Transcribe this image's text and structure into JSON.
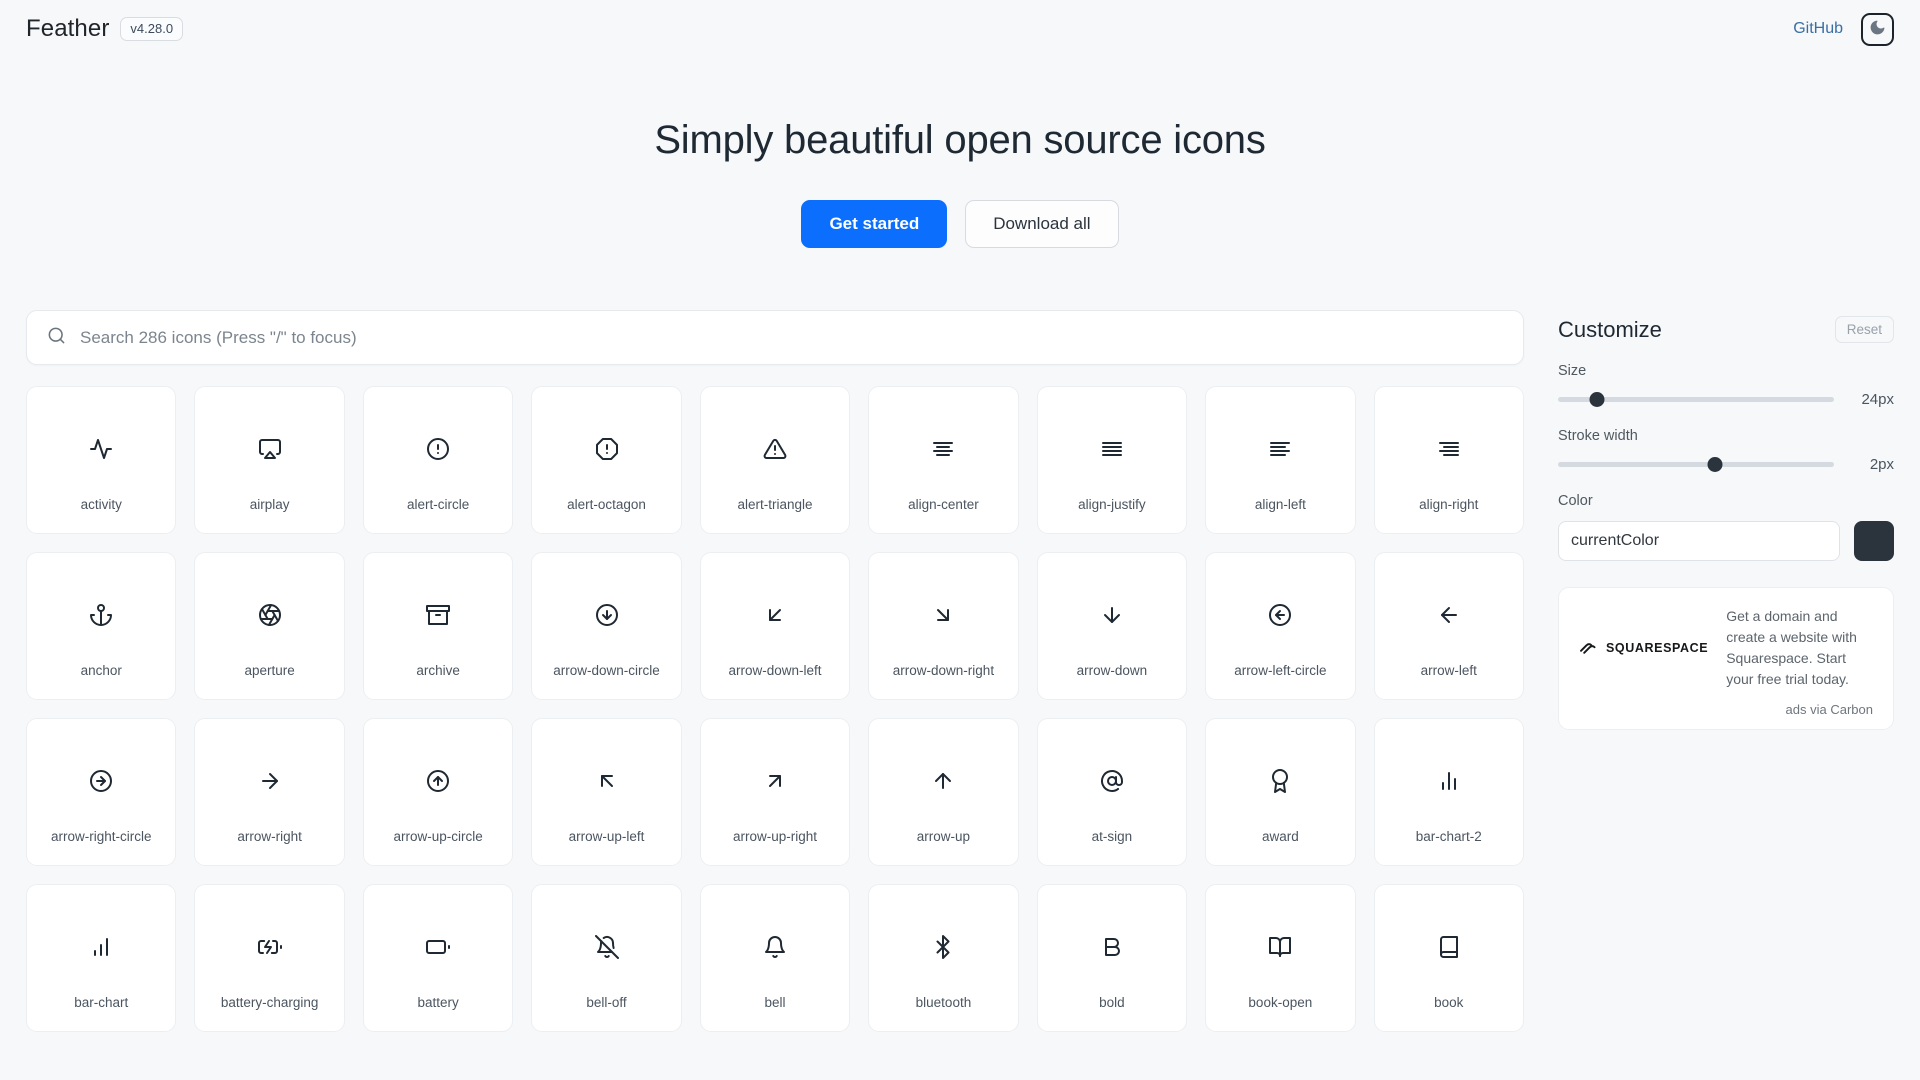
{
  "header": {
    "brand": "Feather",
    "version": "v4.28.0",
    "github_label": "GitHub",
    "theme_toggle_icon": "moon-icon"
  },
  "hero": {
    "title": "Simply beautiful open source icons",
    "primary_button": "Get started",
    "secondary_button": "Download all"
  },
  "search": {
    "icon": "search-icon",
    "placeholder": "Search 286 icons (Press \"/\" to focus)",
    "value": "",
    "icon_count": 286
  },
  "customize": {
    "title": "Customize",
    "reset_label": "Reset",
    "size": {
      "label": "Size",
      "value": "24px",
      "percent": 14
    },
    "stroke": {
      "label": "Stroke width",
      "value": "2px",
      "percent": 57
    },
    "color": {
      "label": "Color",
      "value": "currentColor",
      "swatch": "#2b333c"
    }
  },
  "ad": {
    "logo_name": "squarespace-logo",
    "logo_text": "SQUARESPACE",
    "text": "Get a domain and create a website with Squarespace. Start your free trial today.",
    "footer": "ads via Carbon"
  },
  "icons": [
    {
      "name": "activity"
    },
    {
      "name": "airplay"
    },
    {
      "name": "alert-circle"
    },
    {
      "name": "alert-octagon"
    },
    {
      "name": "alert-triangle"
    },
    {
      "name": "align-center"
    },
    {
      "name": "align-justify"
    },
    {
      "name": "align-left"
    },
    {
      "name": "align-right"
    },
    {
      "name": "anchor"
    },
    {
      "name": "aperture"
    },
    {
      "name": "archive"
    },
    {
      "name": "arrow-down-circle"
    },
    {
      "name": "arrow-down-left"
    },
    {
      "name": "arrow-down-right"
    },
    {
      "name": "arrow-down"
    },
    {
      "name": "arrow-left-circle"
    },
    {
      "name": "arrow-left"
    },
    {
      "name": "arrow-right-circle"
    },
    {
      "name": "arrow-right"
    },
    {
      "name": "arrow-up-circle"
    },
    {
      "name": "arrow-up-left"
    },
    {
      "name": "arrow-up-right"
    },
    {
      "name": "arrow-up"
    },
    {
      "name": "at-sign"
    },
    {
      "name": "award"
    },
    {
      "name": "bar-chart-2"
    },
    {
      "name": "bar-chart"
    },
    {
      "name": "battery-charging"
    },
    {
      "name": "battery"
    },
    {
      "name": "bell-off"
    },
    {
      "name": "bell"
    },
    {
      "name": "bluetooth"
    },
    {
      "name": "bold"
    },
    {
      "name": "book-open"
    },
    {
      "name": "book"
    }
  ]
}
